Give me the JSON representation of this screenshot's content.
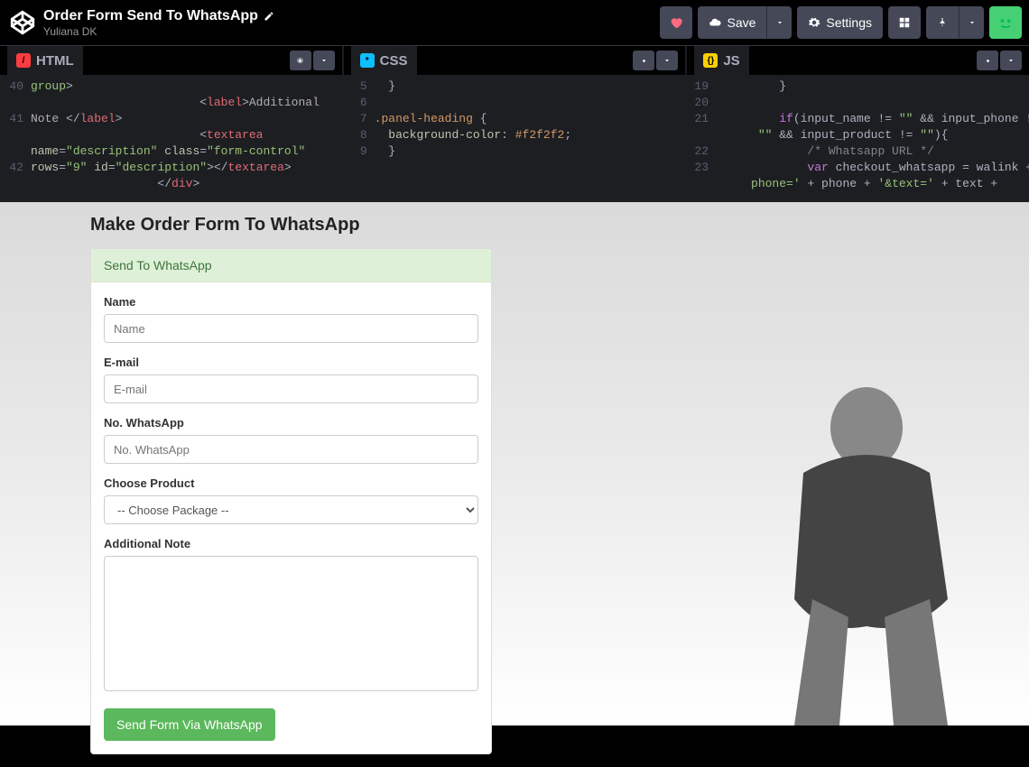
{
  "header": {
    "title": "Order Form Send To WhatsApp",
    "author": "Yuliana DK",
    "save": "Save",
    "settings": "Settings"
  },
  "editors": {
    "html": {
      "label": "HTML",
      "lines": [
        "40",
        "",
        "41",
        "",
        "42"
      ]
    },
    "css": {
      "label": "CSS",
      "lines": [
        "5",
        "6",
        "7",
        "8",
        "9"
      ]
    },
    "js": {
      "label": "JS",
      "lines": [
        "19",
        "20",
        "21",
        "",
        "22",
        "23",
        ""
      ]
    }
  },
  "code": {
    "html_l1a": "group",
    "html_l1b": ">",
    "html_l2a": "                        <",
    "html_l2b": "label",
    "html_l2c": ">",
    "html_l2d": "Additional",
    "html_l3a": "Note",
    "html_l3b": " </",
    "html_l3c": "label",
    "html_l3d": ">",
    "html_l4a": "                        <",
    "html_l4b": "textarea",
    "html_l5a": "name",
    "html_l5b": "=",
    "html_l5c": "\"description\"",
    "html_l5d": " class",
    "html_l5e": "=",
    "html_l5f": "\"form-control\"",
    "html_l6a": "rows",
    "html_l6b": "=",
    "html_l6c": "\"9\"",
    "html_l6d": " id",
    "html_l6e": "=",
    "html_l6f": "\"description\"",
    "html_l6g": "></",
    "html_l6h": "textarea",
    "html_l6i": ">",
    "html_l7a": "                  </",
    "html_l7b": "div",
    "html_l7c": ">",
    "css_l1": "  }",
    "css_l2a": ".panel-heading",
    "css_l2b": " {",
    "css_l3a": "  background-color",
    "css_l3b": ": ",
    "css_l3c": "#f2f2f2",
    "css_l3d": ";",
    "css_l4": "  }",
    "js_l1": "         }",
    "js_l2a": "         if",
    "js_l2b": "(input_name != ",
    "js_l2c": "\"\"",
    "js_l2d": " && input_phone != ",
    "js_l3a": "      ",
    "js_l3b": "\"\"",
    "js_l3c": " && input_product != ",
    "js_l3d": "\"\"",
    "js_l3e": "){",
    "js_l4": "             /* Whatsapp URL */",
    "js_l5a": "             var",
    "js_l5b": " checkout_whatsapp = walink + ",
    "js_l5c": "'?",
    "js_l6a": "     phone='",
    "js_l6b": " + phone + ",
    "js_l6c": "'&text='",
    "js_l6d": " + text + "
  },
  "preview": {
    "page_title": "Make Order Form To WhatsApp",
    "panel_heading": "Send To WhatsApp",
    "name_label": "Name",
    "name_placeholder": "Name",
    "email_label": "E-mail",
    "email_placeholder": "E-mail",
    "phone_label": "No. WhatsApp",
    "phone_placeholder": "No. WhatsApp",
    "product_label": "Choose Product",
    "product_option": "-- Choose Package --",
    "note_label": "Additional Note",
    "submit": "Send Form Via WhatsApp"
  }
}
